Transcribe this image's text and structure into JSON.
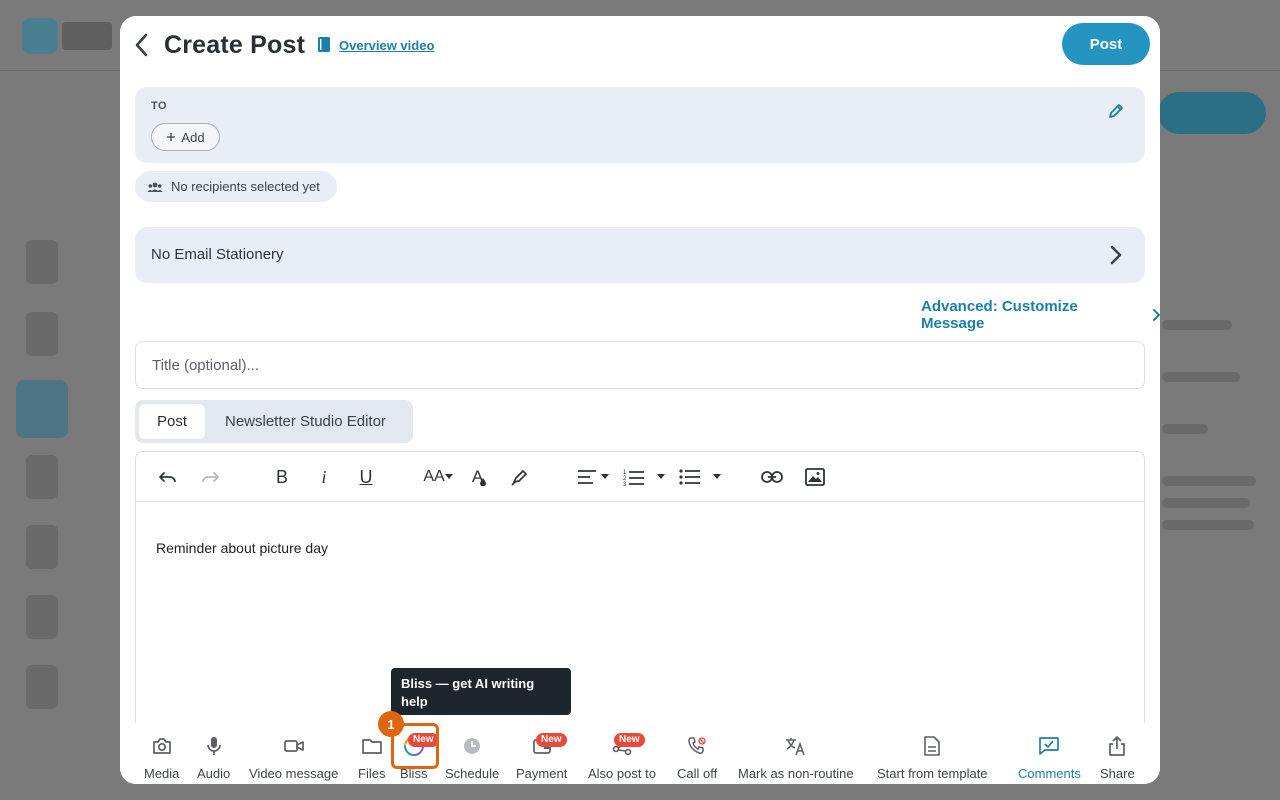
{
  "header": {
    "title": "Create Post",
    "overview_link": "Overview video",
    "post_button": "Post"
  },
  "recipients": {
    "to_label": "TO",
    "add_label": "Add",
    "status": "No recipients selected yet"
  },
  "stationery": {
    "label": "No Email Stationery"
  },
  "advanced_link": "Advanced: Customize Message",
  "title_field": {
    "placeholder": "Title (optional)...",
    "value": ""
  },
  "editor_tabs": {
    "post": "Post",
    "newsletter": "Newsletter Studio Editor"
  },
  "toolbar": {
    "undo": "undo-icon",
    "redo": "redo-icon",
    "bold": "B",
    "italic": "i",
    "underline": "U",
    "font_size": "AA",
    "text_color": "A",
    "highlight": "highlighter-icon",
    "align": "align-icon",
    "numbered_list": "numbered-list-icon",
    "bullet_list": "bullet-list-icon",
    "link": "link-icon",
    "image": "image-icon"
  },
  "editor": {
    "body": "Reminder about picture day"
  },
  "tooltip": {
    "text": "Bliss — get AI writing help"
  },
  "guide": {
    "step": "1"
  },
  "bottom_bar": {
    "new_badge": "New",
    "items": [
      {
        "label": "Media",
        "icon": "camera-icon"
      },
      {
        "label": "Audio",
        "icon": "microphone-icon"
      },
      {
        "label": "Video message",
        "icon": "video-camera-icon"
      },
      {
        "label": "Files",
        "icon": "folder-icon"
      },
      {
        "label": "Bliss",
        "icon": "bliss-ai-icon",
        "badge": "New"
      },
      {
        "label": "Schedule",
        "icon": "clock-icon"
      },
      {
        "label": "Payment",
        "icon": "payment-icon",
        "badge": "New"
      },
      {
        "label": "Also post to",
        "icon": "share-network-icon",
        "badge": "New"
      },
      {
        "label": "Call off",
        "icon": "phone-off-icon"
      },
      {
        "label": "Mark as non-routine",
        "icon": "translate-icon"
      },
      {
        "label": "Start from template",
        "icon": "document-icon"
      },
      {
        "label": "Comments",
        "icon": "comments-icon",
        "active": true
      },
      {
        "label": "Share",
        "icon": "share-icon"
      }
    ]
  },
  "colors": {
    "accent": "#2694c1",
    "link": "#1d7fa8",
    "badge": "#e8493a",
    "highlight": "#e0650f",
    "panel": "#e9edf5"
  }
}
